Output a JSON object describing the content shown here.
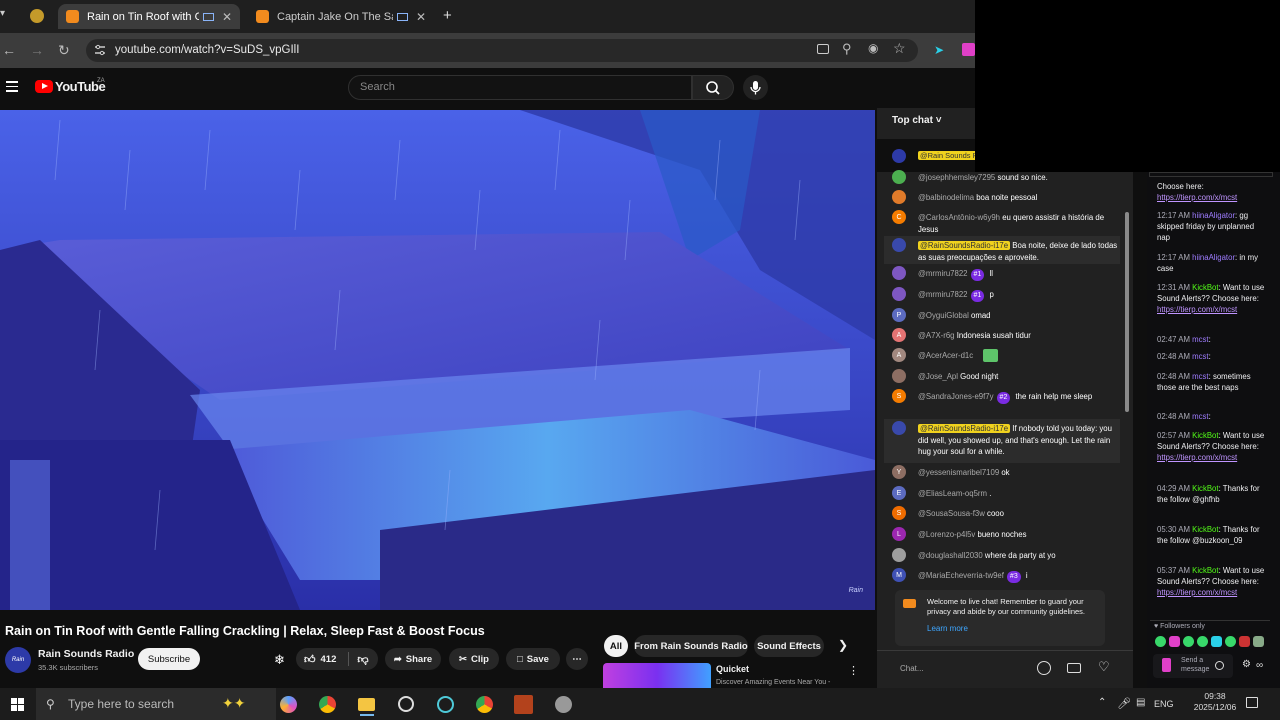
{
  "browser": {
    "tabs": [
      {
        "label": "Rain on Tin Roof with Gentle"
      },
      {
        "label": "Captain Jake On The Saga"
      }
    ],
    "url": "youtube.com/watch?v=SuDS_vpGIlI"
  },
  "youtube": {
    "logo": "YouTube",
    "country": "ZA",
    "search_placeholder": "Search"
  },
  "video": {
    "watermark": "Rain",
    "title": "Rain on Tin Roof with Gentle Falling Crackling | Relax, Sleep Fast & Boost Focus",
    "channel": "Rain Sounds Radio",
    "subscribers": "35.3K subscribers",
    "subscribe": "Subscribe",
    "likes": "412",
    "share": "Share",
    "clip": "Clip",
    "save": "Save"
  },
  "chips": [
    "All",
    "From Rain Sounds Radio",
    "Sound Effects"
  ],
  "recommended": {
    "title": "Quicket",
    "subtitle": "Discover Amazing Events Near You -"
  },
  "chat": {
    "header": "Top chat",
    "pinned": "@Rain Sounds R",
    "messages": [
      {
        "user": "@josephhemsley7295",
        "text": "sound so nice.",
        "color": "#4caf50",
        "initial": ""
      },
      {
        "user": "@balbinodelima",
        "text": "boa noite pessoal",
        "color": "#e07b2a",
        "initial": ""
      },
      {
        "user": "@CarlosAntônio-w6y9h",
        "text": "eu quero assistir a história de Jesus",
        "color": "#f57c00",
        "initial": "C"
      },
      {
        "user": "@RainSoundsRadio-i17e",
        "text": "Boa noite, deixe de lado todas as suas preocupações e aproveite.",
        "color": "#3949ab",
        "initial": "",
        "owner": true
      },
      {
        "user": "@mrmiru7822",
        "badge": "#1",
        "text": "ll",
        "color": "#7e57c2",
        "initial": ""
      },
      {
        "user": "@mrmiru7822",
        "badge": "#1",
        "text": "p",
        "color": "#7e57c2",
        "initial": ""
      },
      {
        "user": "@OyguiGlobal",
        "text": "omad",
        "color": "#5c6bc0",
        "initial": "P"
      },
      {
        "user": "@A7X-r6g",
        "text": "Indonesia susah tidur",
        "color": "#e57373",
        "initial": "A"
      },
      {
        "user": "@AcerAcer-d1c",
        "text": "",
        "color": "#a1887f",
        "initial": "A"
      },
      {
        "user": "@Jose_Apl",
        "text": "Good night",
        "color": "#8d6e63",
        "initial": ""
      },
      {
        "user": "@SandraJones-e9f7y",
        "badge": "#2",
        "text": "the rain help me sleep",
        "color": "#f57c00",
        "initial": "S"
      },
      {
        "user": "@RainSoundsRadio-i17e",
        "text": "If nobody told you today: you did well, you showed up, and that's enough. Let the rain hug your soul for a while.",
        "color": "#3949ab",
        "initial": "",
        "owner": true
      },
      {
        "user": "@yessenismaribel7109",
        "text": "ok",
        "color": "#8d6e63",
        "initial": "Y"
      },
      {
        "user": "@EliasLeam-oq5rm",
        "text": ".",
        "color": "#5c6bc0",
        "initial": "E"
      },
      {
        "user": "@SousaSousa-f3w",
        "text": "cooo",
        "color": "#ef6c00",
        "initial": "S"
      },
      {
        "user": "@Lorenzo-p4l5v",
        "text": "bueno noches",
        "color": "#9c27b0",
        "initial": "L"
      },
      {
        "user": "@douglashall2030",
        "text": "where da party at yo",
        "color": "#9e9e9e",
        "initial": ""
      },
      {
        "user": "@MariaEcheverria-tw9ef",
        "badge": "#3",
        "text": "i",
        "color": "#3f51b5",
        "initial": "M"
      }
    ],
    "welcome": "Welcome to live chat! Remember to guard your privacy and abide by our community guidelines.",
    "learn_more": "Learn more",
    "input_placeholder": "Chat..."
  },
  "twitch": {
    "lines": [
      {
        "time": "",
        "user": "",
        "text": "Choose here:",
        "link": "https://tierp.com/x/mcst"
      },
      {
        "time": "12:17 AM",
        "user": "hiinaAligator",
        "text": "gg skipped friday by unplanned nap"
      },
      {
        "time": "12:17 AM",
        "user": "hiinaAligator",
        "text": "in my case"
      },
      {
        "time": "12:31 AM",
        "user": "KickBot",
        "text": "Want to use Sound Alerts?? Choose here:",
        "link": "https://tierp.com/x/mcst"
      },
      {
        "time": "02:47 AM",
        "user": "mcst",
        "text": ""
      },
      {
        "time": "02:48 AM",
        "user": "mcst",
        "text": ""
      },
      {
        "time": "02:48 AM",
        "user": "mcst",
        "text": "sometimes those are the best naps"
      },
      {
        "time": "02:48 AM",
        "user": "mcst",
        "text": ""
      },
      {
        "time": "02:57 AM",
        "user": "KickBot",
        "text": "Want to use Sound Alerts?? Choose here:",
        "link": "https://tierp.com/x/mcst"
      },
      {
        "time": "04:29 AM",
        "user": "KickBot",
        "text": "Thanks for the follow @ghfhb"
      },
      {
        "time": "05:30 AM",
        "user": "KickBot",
        "text": "Thanks for the follow @buzkoon_09"
      },
      {
        "time": "05:37 AM",
        "user": "KickBot",
        "text": "Want to use Sound Alerts?? Choose here:",
        "link": "https://tierp.com/x/mcst"
      }
    ],
    "followers_only": "Followers only",
    "send": "Send a message"
  },
  "taskbar": {
    "search_placeholder": "Type here to search",
    "lang": "ENG",
    "time": "09:38",
    "date": "2025/12/06"
  }
}
